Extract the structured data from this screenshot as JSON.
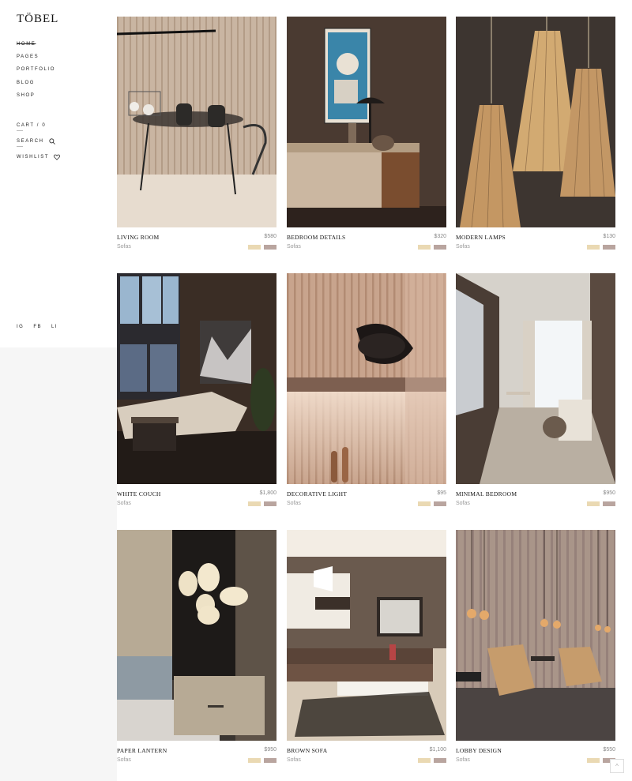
{
  "brand": {
    "logo": "TÖBEL"
  },
  "nav": [
    "HOME",
    "PAGES",
    "PORTFOLIO",
    "BLOG",
    "SHOP"
  ],
  "tools": {
    "cart": "CART / 0",
    "search": "SEARCH",
    "wishlist": "WISHLIST"
  },
  "social": [
    "IG",
    "FB",
    "LI"
  ],
  "colors": {
    "swatch_a": "#ead9b3",
    "swatch_b": "#b9a59f"
  },
  "products": [
    {
      "title": "LIVING ROOM",
      "price": "$580",
      "category": "Sofas"
    },
    {
      "title": "BEDROOM DETAILS",
      "price": "$320",
      "category": "Sofas"
    },
    {
      "title": "MODERN LAMPS",
      "price": "$130",
      "category": "Sofas"
    },
    {
      "title": "WHITE COUCH",
      "price": "$1,800",
      "category": "Sofas"
    },
    {
      "title": "DECORATIVE LIGHT",
      "price": "$95",
      "category": "Sofas"
    },
    {
      "title": "MINIMAL BEDROOM",
      "price": "$950",
      "category": "Sofas"
    },
    {
      "title": "PAPER LANTERN",
      "price": "$950",
      "category": "Sofas"
    },
    {
      "title": "BROWN SOFA",
      "price": "$1,100",
      "category": "Sofas"
    },
    {
      "title": "LOBBY DESIGN",
      "price": "$550",
      "category": "Sofas"
    }
  ],
  "back_to_top": "^"
}
